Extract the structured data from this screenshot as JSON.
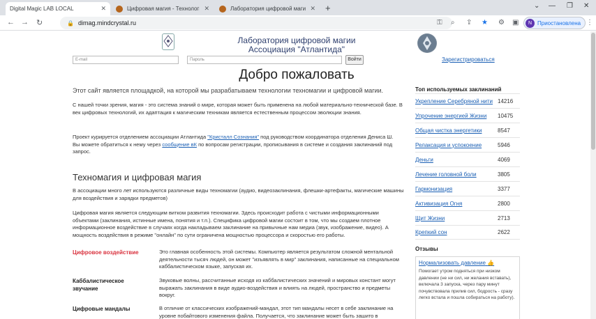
{
  "browser": {
    "tabs": [
      {
        "title": "Digital Magic LAB LOCAL",
        "active": true
      },
      {
        "title": "Цифровая магия - Технологи",
        "active": false
      },
      {
        "title": "Лаборатория цифровой магии",
        "active": false
      }
    ],
    "url": "dimag.mindcrystal.ru",
    "profile_label": "Приостановлена",
    "profile_initial": "N"
  },
  "header": {
    "title_line1": "Лаборатория цифровой магии",
    "title_line2": "Ассоциация \"Атлантида\"",
    "email_placeholder": "E-mail",
    "password_placeholder": "Пароль",
    "login_button": "Войти",
    "register_link": "Зарегистрироваться"
  },
  "main": {
    "heading": "Добро пожаловать",
    "intro": "Этот сайт является площадкой, на которой мы разрабатываем технологии техномагии и цифровой магии.",
    "para1": "С нашей точки зрения, магия - это система знаний о мире, которая может быть применена на любой материально-технической базе. В век цифровых технологий, их адаптация к магическим техникам является естественным процессом эволюции знания.",
    "para2_before": "Проект курируется отделением ассоциации Атлантида ",
    "para2_link": "\"Кристалл Сознания\"",
    "para2_after": " под руководством координатора отделения Дениса Ш.",
    "para2_line2_before": "Вы можете обратиться к нему через ",
    "para2_line2_link": "сообщение вК",
    "para2_line2_after": " по вопросам регистрации, прописывания в системе и создания заклинаний под запрос.",
    "section_heading": "Техномагия и цифровая магия",
    "para3": "В ассоциации много лет используются различные виды техномагии (аудио, видеозаклинания, флешки-артефакты, магические машины для воздействия и зарядки предметов)",
    "para4": "Цифровая магия является следующим витком развития техномагии. Здесь происходит работа с чистыми информационными объектами (заклинания, истинные имена, понятия и т.п.). Специфика цифровой магии состоит в том, что мы создаем плотное информационное воздействие в случаях когда накладываем заклинание на привычные нам медиа (звук, изображение, видео). А мощность воздействия в режиме \"онлайн\" по сути ограничена мощностью процессора и скоростью его работы.",
    "features": [
      {
        "name": "Цифровое воздействие",
        "desc": "Это главная особенность этой системы. Компьютер является результатом сложной ментальной деятельности тысяч людей, он может \"изъявлять в мир\" заклинания, написанные на специальном каббалистическом языке, запуская их."
      },
      {
        "name": "Каббалистическое звучание",
        "desc": "Звуковые волны, рассчитанные исходя из каббалистических значений и мировых констант могут выражать заклинания в виде аудио-воздействия и влиять на людей, пространство и предметы вокруг."
      },
      {
        "name": "Цифровые мандалы",
        "desc": "В отличие от классических изображений-мандал, этот тип мандалы несет в себе заклинание на уровне побайтового изменения файла. Получается, что заклинание может быть зашито в"
      }
    ]
  },
  "sidebar": {
    "top_heading": "Топ используемых заклинаний",
    "spells": [
      {
        "name": "Укрепление Серебряной нити",
        "count": "14216"
      },
      {
        "name": "Упрочение энергией Жизни",
        "count": "10475"
      },
      {
        "name": "Общая чистка энергетики",
        "count": "8547"
      },
      {
        "name": "Релаксация и успокоение",
        "count": "5946"
      },
      {
        "name": "Деньги",
        "count": "4069"
      },
      {
        "name": "Лечение головной боли",
        "count": "3805"
      },
      {
        "name": "Гармонизация",
        "count": "3377"
      },
      {
        "name": "Активизация Огня",
        "count": "2800"
      },
      {
        "name": "Щит Жизни",
        "count": "2713"
      },
      {
        "name": "Крепкий сон",
        "count": "2622"
      }
    ],
    "reviews_heading": "Отзывы",
    "review_title": "Нормализовать давление",
    "review_body": "Помогает утром подняться при низком давлении (не ни сил, ни желания вставать), включала 3 запуска, через пару минут почувствовала прилив сил, бодрость - сразу легко встала и пошла собираться на работу)."
  }
}
